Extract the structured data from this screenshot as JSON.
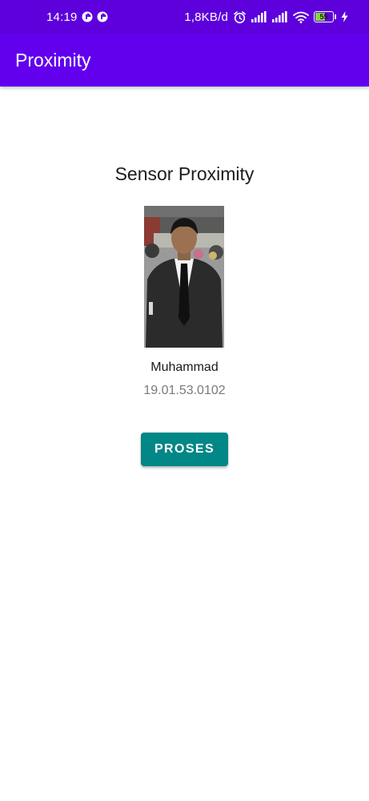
{
  "status_bar": {
    "time": "14:19",
    "network_speed": "1,8KB/d",
    "battery_level": "55",
    "icons": [
      "notification-app-icon",
      "notification-app-icon",
      "alarm-icon",
      "signal-icon",
      "signal-icon",
      "wifi-icon",
      "battery-icon",
      "charging-icon"
    ]
  },
  "app_bar": {
    "title": "Proximity",
    "color": "#6200ee"
  },
  "content": {
    "heading": "Sensor Proximity",
    "photo": "profile-photo",
    "name": "Muhammad",
    "nim": "19.01.53.0102",
    "button_label": "PROSES",
    "button_color": "#018786"
  }
}
